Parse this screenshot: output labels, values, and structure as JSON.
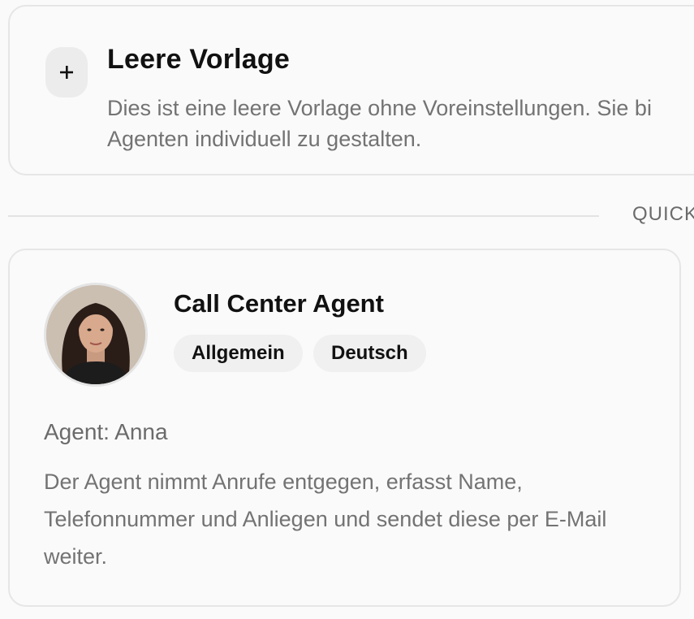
{
  "blank_template": {
    "icon": "plus-icon",
    "title": "Leere Vorlage",
    "description": "Dies ist eine leere Vorlage ohne Voreinstellungen. Sie bi Agenten individuell zu gestalten."
  },
  "divider": {
    "label": "QUICK"
  },
  "agent_card": {
    "avatar": "avatar-photo",
    "title": "Call Center Agent",
    "tags": [
      "Allgemein",
      "Deutsch"
    ],
    "agent_name": "Agent: Anna",
    "description": "Der Agent nimmt Anrufe entgegen, erfasst Name, Telefonnummer und Anliegen und sendet diese per E-Mail weiter."
  },
  "colors": {
    "background": "#fafafa",
    "border": "#e6e6e6",
    "muted_text": "#737373",
    "tag_bg": "#f0f0f0"
  }
}
